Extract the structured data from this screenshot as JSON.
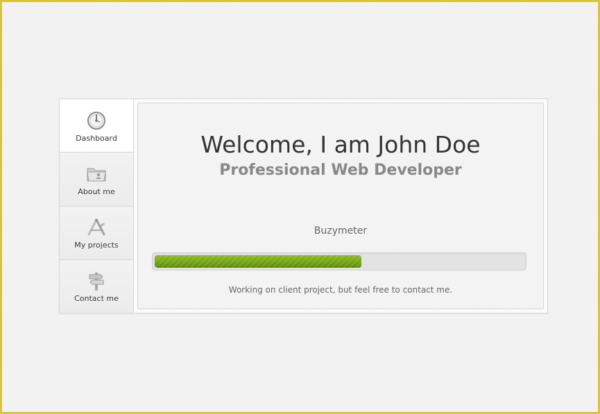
{
  "nav": {
    "items": [
      {
        "label": "Dashboard",
        "icon": "dashboard-gauge-icon"
      },
      {
        "label": "About me",
        "icon": "folder-user-icon"
      },
      {
        "label": "My projects",
        "icon": "projects-tools-icon"
      },
      {
        "label": "Contact me",
        "icon": "signpost-icon"
      }
    ],
    "active_index": 0
  },
  "main": {
    "title": "Welcome, I am John Doe",
    "subtitle": "Professional Web Developer",
    "meter_label": "Buzymeter",
    "progress_fraction": 0.56,
    "status": "Working on client project, but feel free to contact me."
  },
  "colors": {
    "accent": "#6f9e12",
    "frame": "#d9c43a"
  }
}
